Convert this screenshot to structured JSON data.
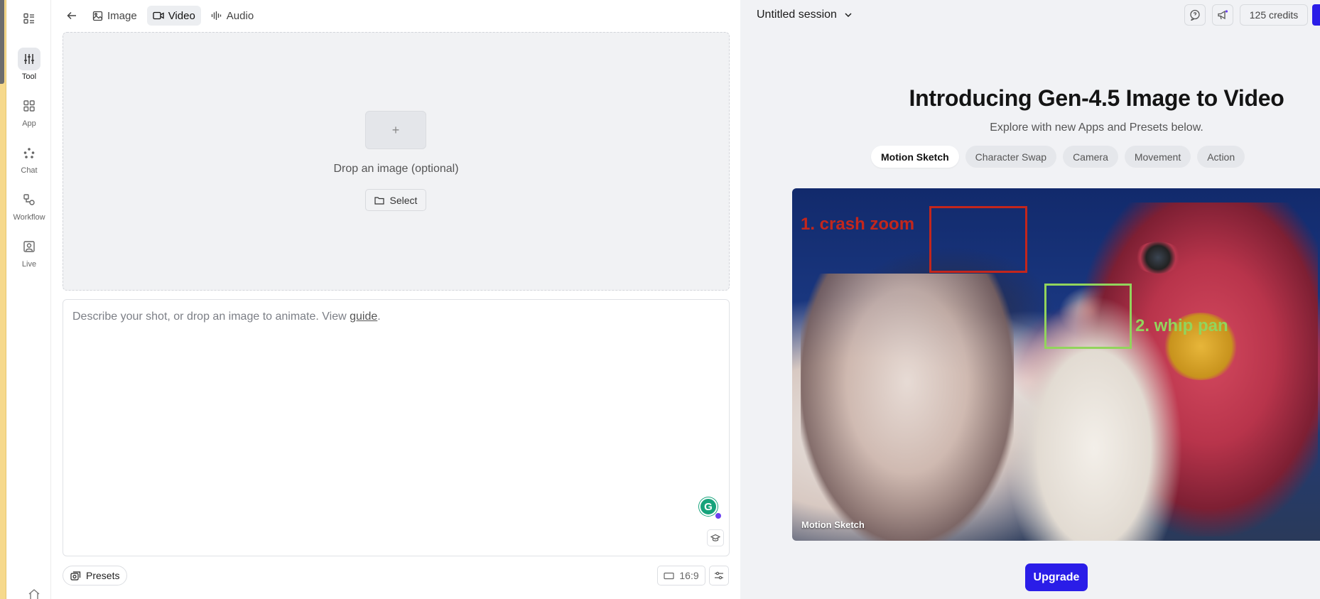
{
  "sidebar": {
    "items": [
      {
        "label": "Tool",
        "icon": "sliders-icon"
      },
      {
        "label": "App",
        "icon": "grid-icon"
      },
      {
        "label": "Chat",
        "icon": "dots-icon"
      },
      {
        "label": "Workflow",
        "icon": "workflow-icon"
      },
      {
        "label": "Live",
        "icon": "live-icon"
      }
    ]
  },
  "topnav": {
    "tabs": [
      {
        "label": "Image",
        "icon": "image-icon"
      },
      {
        "label": "Video",
        "icon": "video-icon"
      },
      {
        "label": "Audio",
        "icon": "audio-icon"
      }
    ],
    "active_tab": "Video"
  },
  "dropzone": {
    "plus": "+",
    "text": "Drop an image (optional)",
    "select_label": "Select"
  },
  "prompt": {
    "placeholder_before": "Describe your shot, or drop an image to animate. View ",
    "guide_link": "guide",
    "placeholder_after": ".",
    "grammarly_badge": "G"
  },
  "footer": {
    "presets_label": "Presets",
    "ratio_label": "16:9"
  },
  "header": {
    "session_title": "Untitled session",
    "credits_label": "125 credits"
  },
  "hero": {
    "title": "Introducing Gen-4.5 Image to Video",
    "subtitle": "Explore with new Apps and Presets below.",
    "chips": [
      "Motion Sketch",
      "Character Swap",
      "Camera",
      "Movement",
      "Action"
    ],
    "active_chip": "Motion Sketch"
  },
  "preview": {
    "annotation_1": "1. crash zoom",
    "annotation_2": "2. whip pan",
    "caption": "Motion Sketch"
  },
  "upgrade_label": "Upgrade",
  "colors": {
    "accent": "#2a1de8",
    "annotation_red": "#c3261c",
    "annotation_green": "#92d45c"
  }
}
